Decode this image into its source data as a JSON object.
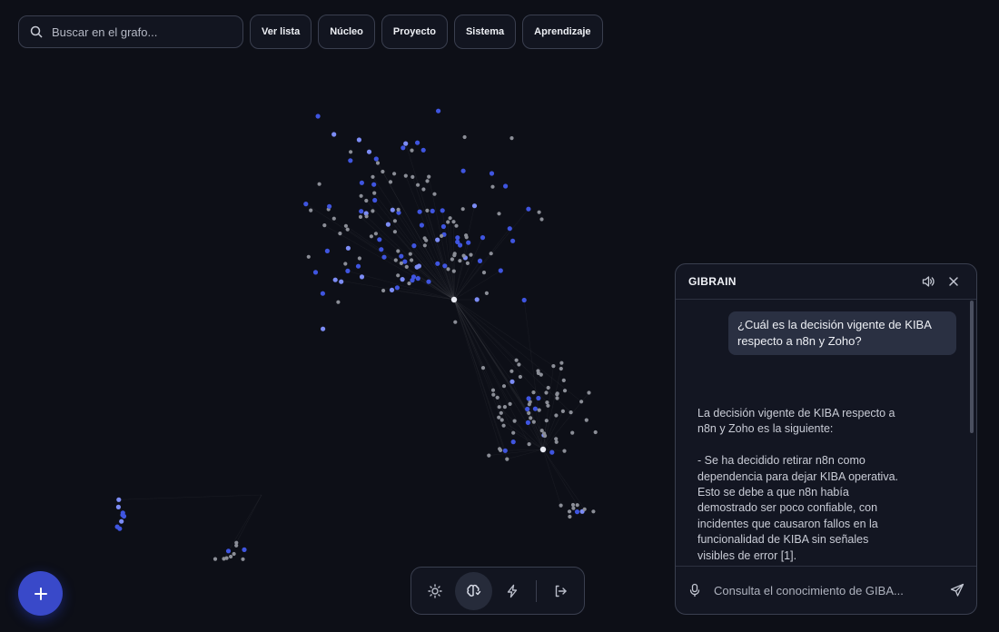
{
  "search": {
    "placeholder": "Buscar en el grafo...",
    "icon": "search-icon"
  },
  "filters": [
    "Ver lista",
    "Núcleo",
    "Proyecto",
    "Sistema",
    "Aprendizaje"
  ],
  "fab": {
    "icon": "plus-icon"
  },
  "toolbar": {
    "icons": [
      "sun-icon",
      "brain-icon",
      "lightning-icon",
      "logout-icon"
    ],
    "active": "brain-icon"
  },
  "chat": {
    "title": "GIBRAIN",
    "user_message": "¿Cuál es la decisión vigente de KIBA respecto a n8n y Zoho?",
    "assistant_message": "La decisión vigente de KIBA respecto a n8n y Zoho es la siguiente:\n\n- Se ha decidido retirar n8n como dependencia para dejar KIBA operativa. Esto se debe a que n8n había demostrado ser poco confiable, con incidentes que causaron fallos en la funcionalidad de KIBA sin señales visibles de error [1].\n- KIBA ahora utilizará Zoho Mail y Zoho Calendar mediante OAuth y sus APIs REST oficiales, conectando",
    "input_placeholder": "Consulta el conocimiento de GIBA..."
  },
  "colors": {
    "background": "#0d0f17",
    "accent": "#3949c9",
    "node_blue": "#3f55e0",
    "node_gray": "#8b8e97"
  }
}
